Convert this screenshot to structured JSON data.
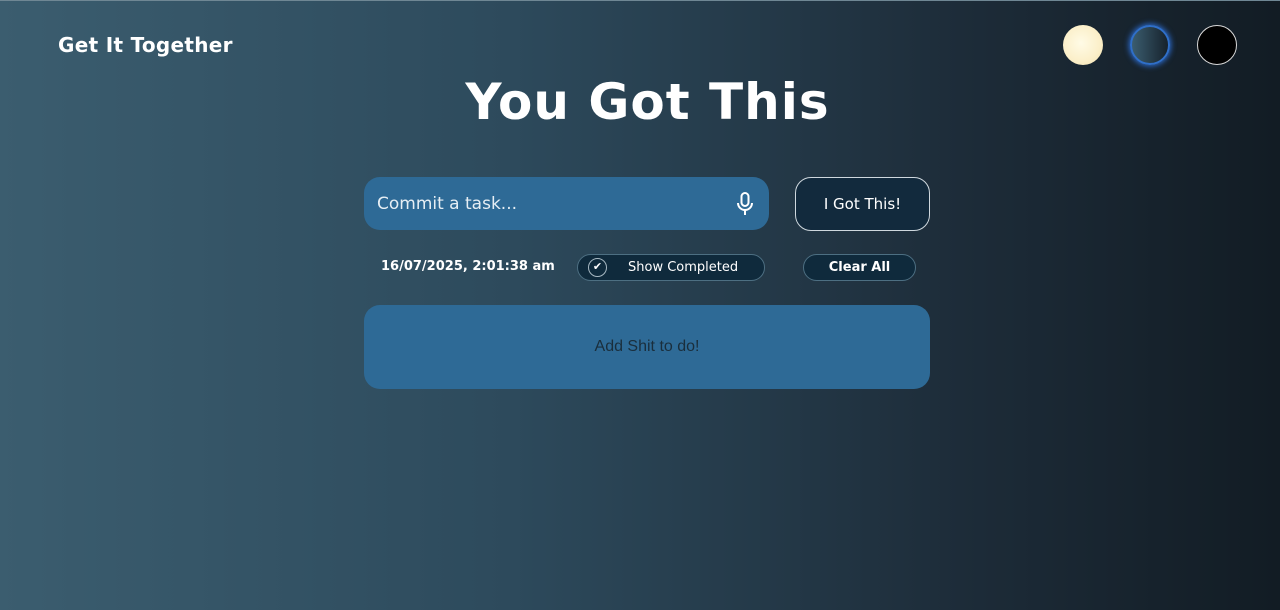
{
  "header": {
    "brand": "Get It Together"
  },
  "themes": [
    {
      "name": "light",
      "color": "#fbefc9"
    },
    {
      "name": "ocean",
      "color": "#2d4a5c",
      "active": true
    },
    {
      "name": "dark",
      "color": "#000000"
    }
  ],
  "main": {
    "headline": "You Got This",
    "task_input": {
      "value": "",
      "placeholder": "Commit a task..."
    },
    "submit_label": "I Got This!",
    "datetime": "16/07/2025, 2:01:38 am",
    "show_completed": {
      "label": "Show Completed",
      "checked": true,
      "check_glyph": "✔"
    },
    "clear_all_label": "Clear All",
    "task_list": {
      "empty_message": "Add Shit to do!"
    }
  },
  "colors": {
    "accent": "#2e6a96",
    "button_dark": "#122a3d",
    "active_ring": "#2f6fc9"
  }
}
